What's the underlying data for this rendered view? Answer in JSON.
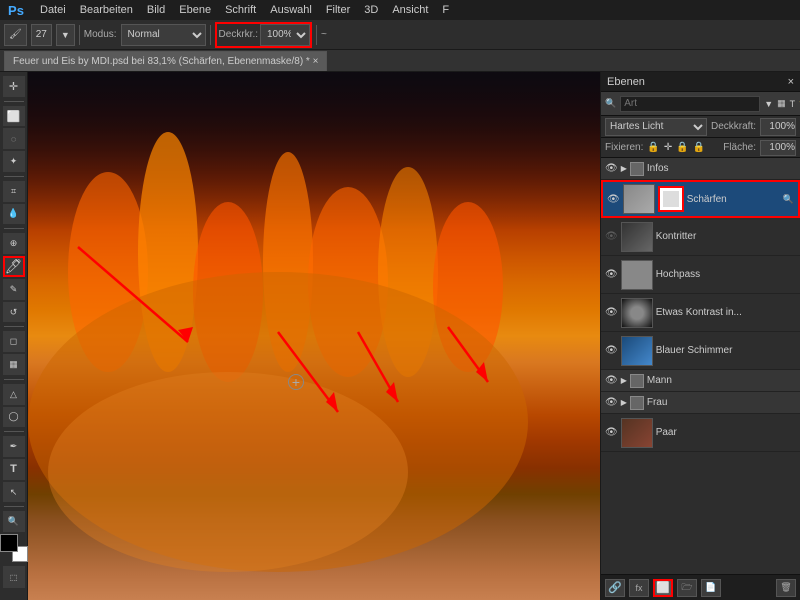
{
  "menubar": {
    "logo": "PS",
    "items": [
      "Datei",
      "Bearbeiten",
      "Bild",
      "Ebene",
      "Schrift",
      "Auswahl",
      "Filter",
      "3D",
      "Ansicht",
      "F"
    ]
  },
  "toolbar_top": {
    "brush_icon": "🖌",
    "size_label": "27",
    "modus_label": "Modus:",
    "modus_value": "Normal",
    "deckkraft_label": "Deckrkr.:",
    "deckkraft_value": "100%",
    "flow_icon": "~"
  },
  "tab": {
    "title": "Feuer und Eis by MDI.psd bei 83,1% (Schärfen, Ebenenmaske/8) * ×",
    "close": "×"
  },
  "left_tools": [
    {
      "name": "move",
      "icon": "✛"
    },
    {
      "name": "select-rect",
      "icon": "⬜"
    },
    {
      "name": "lasso",
      "icon": "⭕"
    },
    {
      "name": "magic-wand",
      "icon": "✦"
    },
    {
      "name": "crop",
      "icon": "⌗"
    },
    {
      "name": "eyedropper",
      "icon": "💉"
    },
    {
      "name": "heal",
      "icon": "⊕"
    },
    {
      "name": "brush",
      "icon": "🖊",
      "active": true
    },
    {
      "name": "clone",
      "icon": "✎"
    },
    {
      "name": "history-brush",
      "icon": "↺"
    },
    {
      "name": "eraser",
      "icon": "⬜"
    },
    {
      "name": "gradient",
      "icon": "▦"
    },
    {
      "name": "blur",
      "icon": "△"
    },
    {
      "name": "dodge",
      "icon": "◯"
    },
    {
      "name": "pen",
      "icon": "✒"
    },
    {
      "name": "text",
      "icon": "T"
    },
    {
      "name": "path-select",
      "icon": "↖"
    },
    {
      "name": "zoom",
      "icon": "🔍"
    }
  ],
  "layers": {
    "panel_title": "Ebenen",
    "search_placeholder": "Art",
    "blend_mode": "Hartes Licht",
    "opacity_label": "Deckkraft:",
    "opacity_value": "100%",
    "flaeche_label": "Fläche:",
    "flaeche_value": "100%",
    "fixieren_label": "Fixieren:",
    "fix_icons": [
      "🔒",
      "✛",
      "🔒",
      "🔒"
    ],
    "items": [
      {
        "type": "group",
        "name": "Infos",
        "expanded": false,
        "eye": true
      },
      {
        "type": "layer",
        "name": "Schärfen",
        "selected": true,
        "eye": true,
        "has_mask": true
      },
      {
        "type": "layer",
        "name": "Kontritter",
        "eye": false,
        "has_mask": false
      },
      {
        "type": "layer",
        "name": "Hochpass",
        "eye": true,
        "has_mask": false
      },
      {
        "type": "layer",
        "name": "Etwas Kontrast in...",
        "eye": true,
        "has_mask": false
      },
      {
        "type": "layer",
        "name": "Blauer Schimmer",
        "eye": true,
        "has_mask": false
      },
      {
        "type": "group",
        "name": "Mann",
        "expanded": false,
        "eye": true
      },
      {
        "type": "group",
        "name": "Frau",
        "expanded": false,
        "eye": true
      },
      {
        "type": "layer",
        "name": "Paar",
        "eye": true,
        "has_mask": false
      }
    ],
    "bottom_buttons": [
      "🔗",
      "fx",
      "⬜",
      "🗁",
      "🗑"
    ]
  },
  "annotations": {
    "arrow1_label": "brush tool highlighted",
    "arrow2_label": "layer mask button highlighted",
    "arrow3_label": "layer row highlighted"
  }
}
